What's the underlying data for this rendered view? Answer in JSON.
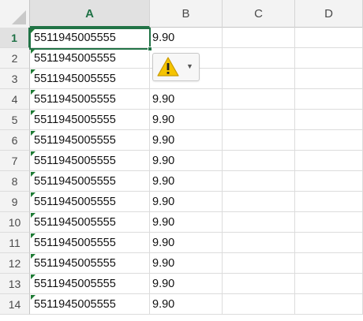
{
  "columns": [
    "A",
    "B",
    "C",
    "D"
  ],
  "selected_column": "A",
  "selected_row": "1",
  "rows": [
    {
      "num": "1",
      "a": "5511945005555",
      "b": "9.90"
    },
    {
      "num": "2",
      "a": "5511945005555",
      "b": ""
    },
    {
      "num": "3",
      "a": "5511945005555",
      "b": ""
    },
    {
      "num": "4",
      "a": "5511945005555",
      "b": "9.90"
    },
    {
      "num": "5",
      "a": "5511945005555",
      "b": "9.90"
    },
    {
      "num": "6",
      "a": "5511945005555",
      "b": "9.90"
    },
    {
      "num": "7",
      "a": "5511945005555",
      "b": "9.90"
    },
    {
      "num": "8",
      "a": "5511945005555",
      "b": "9.90"
    },
    {
      "num": "9",
      "a": "5511945005555",
      "b": "9.90"
    },
    {
      "num": "10",
      "a": "5511945005555",
      "b": "9.90"
    },
    {
      "num": "11",
      "a": "5511945005555",
      "b": "9.90"
    },
    {
      "num": "12",
      "a": "5511945005555",
      "b": "9.90"
    },
    {
      "num": "13",
      "a": "5511945005555",
      "b": "9.90"
    },
    {
      "num": "14",
      "a": "5511945005555",
      "b": "9.90"
    }
  ],
  "error_tag": {
    "icon": "warning-icon",
    "dropdown_icon": "chevron-down-icon",
    "warning_color": "#f5c400"
  },
  "colors": {
    "accent": "#217346",
    "error_indicator": "#1e7b34"
  }
}
